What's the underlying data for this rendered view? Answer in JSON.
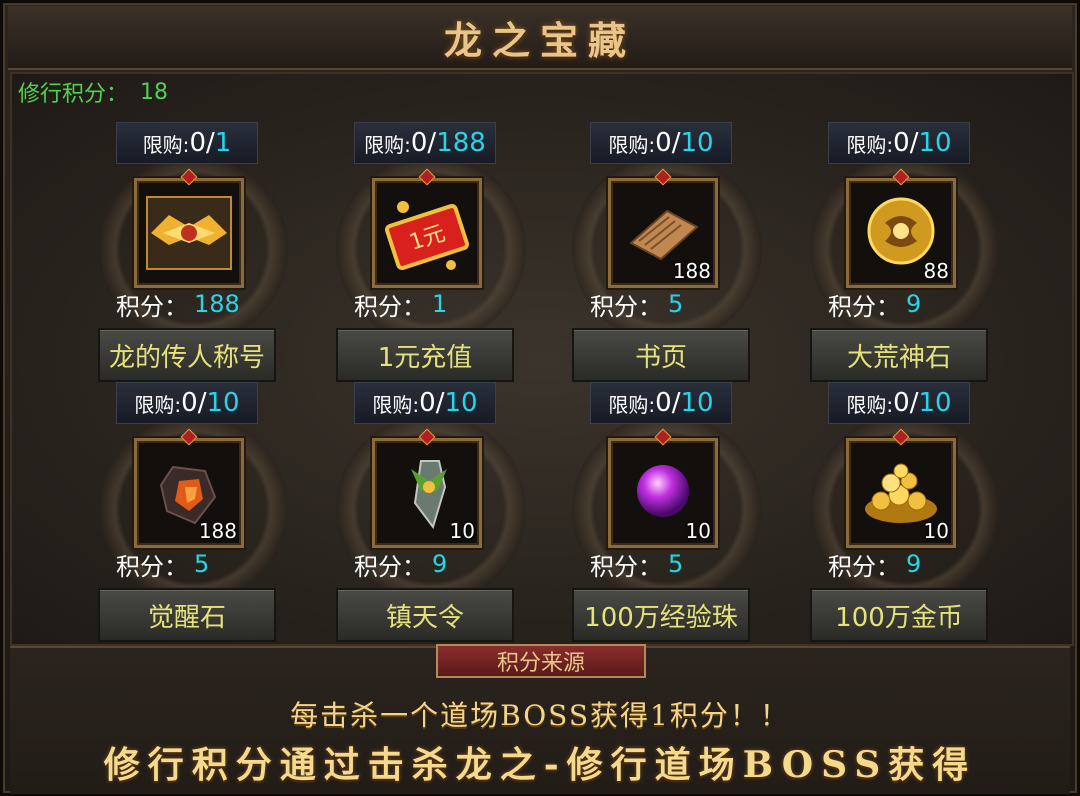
{
  "title": "龙之宝藏",
  "points": {
    "label": "修行积分：",
    "value": "18"
  },
  "limit_label": "限购:",
  "score_label": "积分：",
  "items": [
    {
      "limit_current": "0/",
      "limit_max": "1",
      "qty": "",
      "score": "188",
      "name": "龙的传人称号",
      "icon": "dragon-title-icon"
    },
    {
      "limit_current": "0/",
      "limit_max": "188",
      "qty": "",
      "score": "1",
      "name": "1元充值",
      "icon": "recharge-coupon-icon"
    },
    {
      "limit_current": "0/",
      "limit_max": "10",
      "qty": "188",
      "score": "5",
      "name": "书页",
      "icon": "book-page-icon"
    },
    {
      "limit_current": "0/",
      "limit_max": "10",
      "qty": "88",
      "score": "9",
      "name": "大荒神石",
      "icon": "divine-stone-icon"
    },
    {
      "limit_current": "0/",
      "limit_max": "10",
      "qty": "188",
      "score": "5",
      "name": "觉醒石",
      "icon": "awakening-stone-icon"
    },
    {
      "limit_current": "0/",
      "limit_max": "10",
      "qty": "10",
      "score": "9",
      "name": "镇天令",
      "icon": "heaven-token-icon"
    },
    {
      "limit_current": "0/",
      "limit_max": "10",
      "qty": "10",
      "score": "5",
      "name": "100万经验珠",
      "icon": "exp-orb-icon"
    },
    {
      "limit_current": "0/",
      "limit_max": "10",
      "qty": "10",
      "score": "9",
      "name": "100万金币",
      "icon": "gold-coins-icon"
    }
  ],
  "source": {
    "tab": "积分来源",
    "line1": "每击杀一个道场BOSS获得1积分！！",
    "line2": "修行积分通过击杀龙之-修行道场BOSS获得"
  },
  "colors": {
    "accent_cyan": "#26d6e8",
    "points_green": "#4fd24f",
    "button_text": "#e6e27a",
    "title_gold": "#e9c58a"
  }
}
